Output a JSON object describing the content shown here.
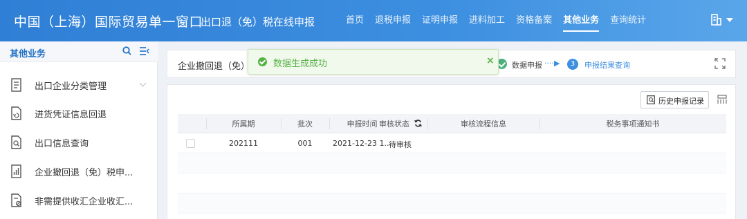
{
  "header": {
    "brand": "中国（上海）国际贸易单一窗口",
    "sub_brand": "出口退（免）税在线申报",
    "nav": [
      "首页",
      "退税申报",
      "证明申报",
      "进料加工",
      "资格备案",
      "其他业务",
      "查询统计"
    ],
    "active_nav": "其他业务"
  },
  "sidebar": {
    "title": "其他业务",
    "items": [
      {
        "label": "出口企业分类管理",
        "icon": "document-list-icon"
      },
      {
        "label": "进货凭证信息回退",
        "icon": "document-return-icon"
      },
      {
        "label": "出口信息查询",
        "icon": "document-search-icon"
      },
      {
        "label": "企业撤回退（免）税申...",
        "icon": "document-chart-icon"
      },
      {
        "label": "非需提供收汇企业收汇...",
        "icon": "document-forbid-icon"
      }
    ]
  },
  "stepbar": {
    "label": "企业撤回退（免）",
    "done_step": "数据申报",
    "arrow": "····▶",
    "current_num": "3",
    "current_step": "申报结果查询"
  },
  "toast": {
    "message": "数据生成成功",
    "close": "×"
  },
  "toolbar": {
    "history_label": "历史申报记录"
  },
  "table": {
    "columns": [
      "所属期",
      "批次",
      "申报时间",
      "审核状态",
      "审核流程信息",
      "税务事项通知书"
    ],
    "rows": [
      {
        "period": "202111",
        "batch": "001",
        "time": "2021-12-23 1...",
        "status": "待审核",
        "flow": "",
        "notice": ""
      }
    ]
  },
  "colors": {
    "header": "#3d8fe0",
    "success": "#56b146",
    "accent": "#1f6fc5"
  }
}
